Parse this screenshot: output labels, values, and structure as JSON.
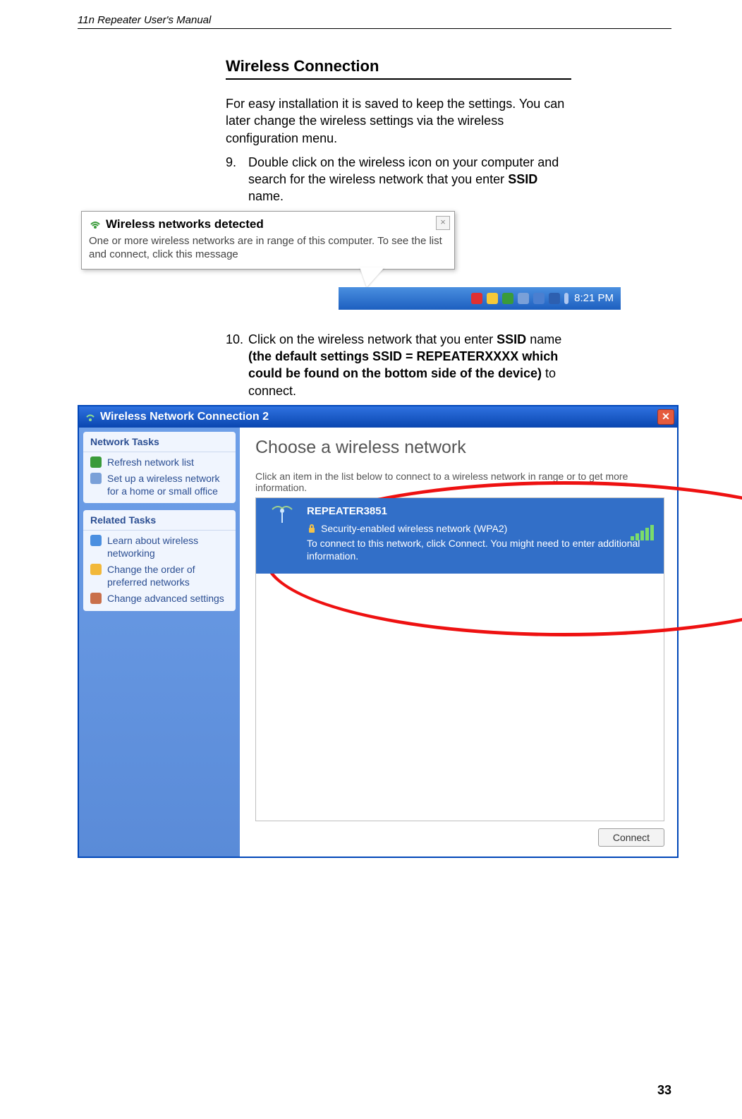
{
  "header": "11n Repeater User's Manual",
  "section_title": "Wireless Connection",
  "intro_para": "For easy installation it is saved to keep the settings. You can later change the wireless settings via the wireless configuration menu.",
  "step9": {
    "num": "9.",
    "text_a": "Double click on the wireless icon on your computer and search for the wireless network that you enter ",
    "bold": "SSID",
    "text_b": " name."
  },
  "balloon": {
    "title": "Wireless networks detected",
    "body": "One or more wireless networks are in range of this computer. To see the list and connect, click this message"
  },
  "systray_time": "8:21 PM",
  "step10": {
    "num": "10.",
    "text_a": "Click on the wireless network that you enter ",
    "bold1": "SSID",
    "text_b": " name ",
    "bold2": "(the default settings SSID = REPEATERXXXX which could be found on the bottom side of the device)",
    "text_c": " to connect."
  },
  "dialog": {
    "title": "Wireless Network Connection 2",
    "sidebar": {
      "group1": "Network Tasks",
      "items1": [
        "Refresh network list",
        "Set up a wireless network for a home or small office"
      ],
      "group2": "Related Tasks",
      "items2": [
        "Learn about wireless networking",
        "Change the order of preferred networks",
        "Change advanced settings"
      ]
    },
    "main": {
      "heading": "Choose a wireless network",
      "sub": "Click an item in the list below to connect to a wireless network in range or to get more information.",
      "ssid": "REPEATER3851",
      "security": "Security-enabled wireless network (WPA2)",
      "help": "To connect to this network, click Connect. You might need to enter additional information.",
      "connect": "Connect"
    }
  },
  "page_number": "33"
}
